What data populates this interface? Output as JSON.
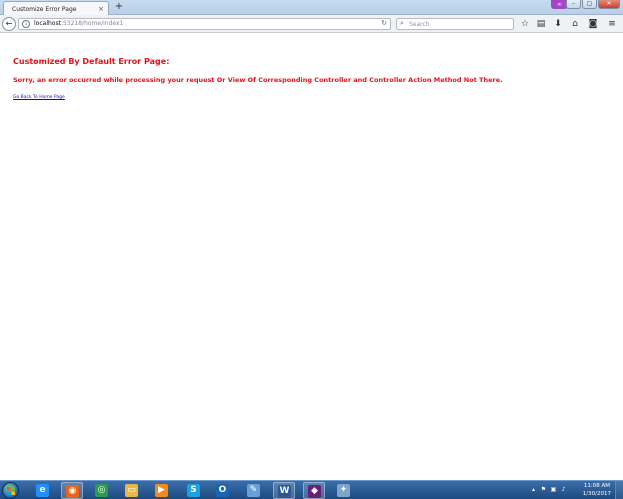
{
  "browser": {
    "tab": {
      "title": "Customize Error Page",
      "close_glyph": "×"
    },
    "newtab_glyph": "+",
    "window_controls": {
      "minimize": "–",
      "maximize": "▢",
      "close": "✕"
    },
    "private_mask_glyph": "∞",
    "nav": {
      "back_glyph": "←",
      "url_host": "localhost",
      "url_rest": ":53218/home/index1",
      "reload_glyph": "↻",
      "search_placeholder": "Search",
      "search_glyph": "⌕",
      "icons": [
        {
          "name": "bookmark-star-icon",
          "glyph": "☆"
        },
        {
          "name": "reading-list-icon",
          "glyph": "▤"
        },
        {
          "name": "downloads-icon",
          "glyph": "⬇"
        },
        {
          "name": "home-icon",
          "glyph": "⌂"
        },
        {
          "name": "pocket-icon",
          "glyph": "◙"
        },
        {
          "name": "menu-icon",
          "glyph": "≡"
        }
      ]
    }
  },
  "page": {
    "heading": "Customized By Default Error Page:",
    "message": "Sorry, an error occurred while processing your request Or View Of Corresponding Controller and Controller Action Method Not There.",
    "home_link": "Go Back To Home Page",
    "accent_color": "#e4141a",
    "link_color": "#0b0bcc"
  },
  "taskbar": {
    "apps": [
      {
        "name": "internet-explorer-icon",
        "glyph": "e",
        "color": "#1e90ff",
        "active": false
      },
      {
        "name": "firefox-icon",
        "glyph": "◉",
        "color": "#e8641b",
        "active": true
      },
      {
        "name": "chrome-icon",
        "glyph": "◎",
        "color": "#2a9d4a",
        "active": false
      },
      {
        "name": "file-explorer-icon",
        "glyph": "▭",
        "color": "#e8b84a",
        "active": false
      },
      {
        "name": "media-player-icon",
        "glyph": "▶",
        "color": "#f08a1a",
        "active": false
      },
      {
        "name": "skype-icon",
        "glyph": "S",
        "color": "#19a3e0",
        "active": false
      },
      {
        "name": "outlook-icon",
        "glyph": "O",
        "color": "#1766b8",
        "active": false
      },
      {
        "name": "paint-icon",
        "glyph": "✎",
        "color": "#6aa0d8",
        "active": false
      },
      {
        "name": "word-icon",
        "glyph": "W",
        "color": "#2b5797",
        "active": true
      },
      {
        "name": "visual-studio-icon",
        "glyph": "◆",
        "color": "#68217a",
        "active": true
      },
      {
        "name": "tools-icon",
        "glyph": "✦",
        "color": "#7fa6c8",
        "active": false
      }
    ],
    "tray_glyphs": [
      "▴",
      "⚑",
      "▣",
      "♪"
    ],
    "time": "11:08 AM",
    "date": "1/30/2017"
  }
}
